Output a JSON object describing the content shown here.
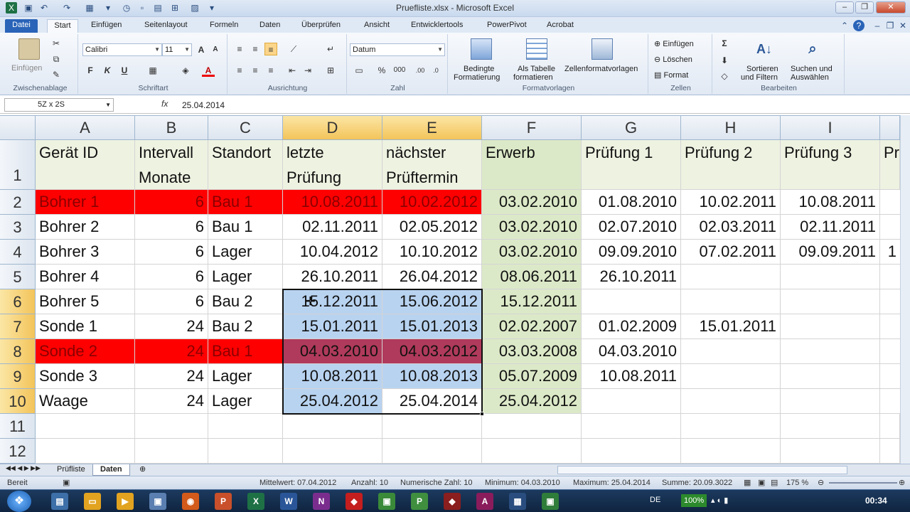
{
  "window": {
    "title": "Pruefliste.xlsx - Microsoft Excel"
  },
  "tabs": [
    "Datei",
    "Start",
    "Einfügen",
    "Seitenlayout",
    "Formeln",
    "Daten",
    "Überprüfen",
    "Ansicht",
    "Entwicklertools",
    "PowerPivot",
    "Acrobat"
  ],
  "ribbon": {
    "paste_label": "Einfügen",
    "clipboard_label": "Zwischenablage",
    "font_name": "Calibri",
    "font_size": "11",
    "font_group_label": "Schriftart",
    "bold": "F",
    "italic": "K",
    "underline": "U",
    "align_group_label": "Ausrichtung",
    "number_format": "Datum",
    "number_group_label": "Zahl",
    "percent": "%",
    "thousands": "000",
    "cond_format_1": "Bedingte",
    "cond_format_2": "Formatierung",
    "as_table_1": "Als Tabelle",
    "as_table_2": "formatieren",
    "cell_styles": "Zellenformatvorlagen",
    "styles_group_label": "Formatvorlagen",
    "insert_label": "Einfügen",
    "delete_label": "Löschen",
    "format_label": "Format",
    "cells_group_label": "Zellen",
    "sort_1": "Sortieren",
    "sort_2": "und Filtern",
    "find_1": "Suchen und",
    "find_2": "Auswählen",
    "edit_group_label": "Bearbeiten"
  },
  "formula_bar": {
    "name_box": "5Z x 2S",
    "fx": "fx",
    "value": "25.04.2014"
  },
  "columns": [
    "A",
    "B",
    "C",
    "D",
    "E",
    "F",
    "G",
    "H",
    "I"
  ],
  "headers": {
    "A": "Gerät ID",
    "B1": "Intervall",
    "B2": "Monate",
    "C": "Standort",
    "D1": "letzte",
    "D2": "Prüfung",
    "E1": "nächster",
    "E2": "Prüftermin",
    "F": "Erwerb",
    "G": "Prüfung 1",
    "H": "Prüfung 2",
    "I": "Prüfung 3",
    "J": "Pr"
  },
  "row_numbers": [
    "1",
    "2",
    "3",
    "4",
    "5",
    "6",
    "7",
    "8",
    "9",
    "10",
    "11",
    "12"
  ],
  "rows": [
    {
      "a": "Bohrer 1",
      "b": "6",
      "c": "Bau 1",
      "d": "10.08.2011",
      "e": "10.02.2012",
      "f": "03.02.2010",
      "g": "01.08.2010",
      "h": "10.02.2011",
      "i": "10.08.2011",
      "j": ""
    },
    {
      "a": "Bohrer 2",
      "b": "6",
      "c": "Bau 1",
      "d": "02.11.2011",
      "e": "02.05.2012",
      "f": "03.02.2010",
      "g": "02.07.2010",
      "h": "02.03.2011",
      "i": "02.11.2011",
      "j": ""
    },
    {
      "a": "Bohrer 3",
      "b": "6",
      "c": "Lager",
      "d": "10.04.2012",
      "e": "10.10.2012",
      "f": "03.02.2010",
      "g": "09.09.2010",
      "h": "07.02.2011",
      "i": "09.09.2011",
      "j": "1"
    },
    {
      "a": "Bohrer 4",
      "b": "6",
      "c": "Lager",
      "d": "26.10.2011",
      "e": "26.04.2012",
      "f": "08.06.2011",
      "g": "26.10.2011",
      "h": "",
      "i": "",
      "j": ""
    },
    {
      "a": "Bohrer 5",
      "b": "6",
      "c": "Bau 2",
      "d": "15.12.2011",
      "e": "15.06.2012",
      "f": "15.12.2011",
      "g": "",
      "h": "",
      "i": "",
      "j": ""
    },
    {
      "a": "Sonde 1",
      "b": "24",
      "c": "Bau 2",
      "d": "15.01.2011",
      "e": "15.01.2013",
      "f": "02.02.2007",
      "g": "01.02.2009",
      "h": "15.01.2011",
      "i": "",
      "j": ""
    },
    {
      "a": "Sonde 2",
      "b": "24",
      "c": "Bau 1",
      "d": "04.03.2010",
      "e": "04.03.2012",
      "f": "03.03.2008",
      "g": "04.03.2010",
      "h": "",
      "i": "",
      "j": ""
    },
    {
      "a": "Sonde 3",
      "b": "24",
      "c": "Lager",
      "d": "10.08.2011",
      "e": "10.08.2013",
      "f": "05.07.2009",
      "g": "10.08.2011",
      "h": "",
      "i": "",
      "j": ""
    },
    {
      "a": "Waage",
      "b": "24",
      "c": "Lager",
      "d": "25.04.2012",
      "e": "25.04.2014",
      "f": "25.04.2012",
      "g": "",
      "h": "",
      "i": "",
      "j": ""
    }
  ],
  "sheets": [
    "Prüfliste",
    "Daten"
  ],
  "status": {
    "ready": "Bereit",
    "average": "Mittelwert: 07.04.2012",
    "count": "Anzahl: 10",
    "num_count": "Numerische Zahl: 10",
    "min": "Minimum: 04.03.2010",
    "max": "Maximum: 25.04.2014",
    "sum": "Summe: 20.09.3022",
    "zoom": "175 %"
  },
  "taskbar": {
    "lang": "DE",
    "time": "00:34",
    "battery": "100%"
  },
  "colors": {
    "red": "#ff0000",
    "selected": "#b8d3f0",
    "overlap": "#b03a5b",
    "green": "#dce9c8",
    "header_tan": "#eef2e1"
  }
}
